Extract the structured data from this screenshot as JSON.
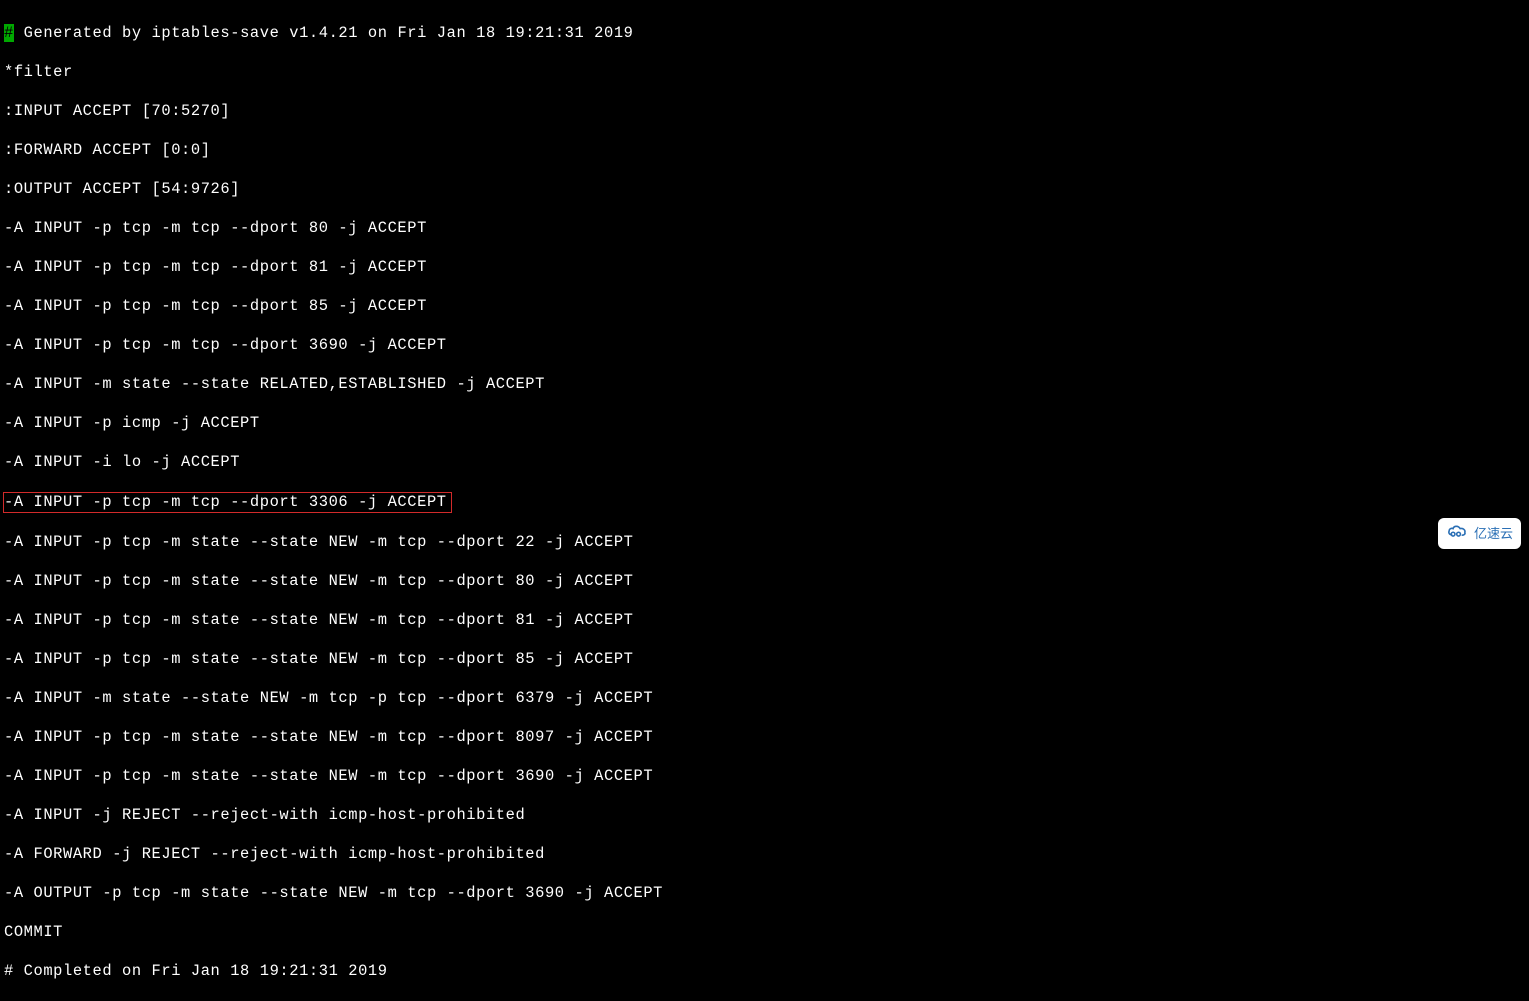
{
  "terminal": {
    "prompt_char": "#",
    "lines": [
      " Generated by iptables-save v1.4.21 on Fri Jan 18 19:21:31 2019",
      "*filter",
      ":INPUT ACCEPT [70:5270]",
      ":FORWARD ACCEPT [0:0]",
      ":OUTPUT ACCEPT [54:9726]",
      "-A INPUT -p tcp -m tcp --dport 80 -j ACCEPT",
      "-A INPUT -p tcp -m tcp --dport 81 -j ACCEPT",
      "-A INPUT -p tcp -m tcp --dport 85 -j ACCEPT",
      "-A INPUT -p tcp -m tcp --dport 3690 -j ACCEPT",
      "-A INPUT -m state --state RELATED,ESTABLISHED -j ACCEPT",
      "-A INPUT -p icmp -j ACCEPT",
      "-A INPUT -i lo -j ACCEPT",
      "-A INPUT -p tcp -m tcp --dport 3306 -j ACCEPT",
      "-A INPUT -p tcp -m state --state NEW -m tcp --dport 22 -j ACCEPT",
      "-A INPUT -p tcp -m state --state NEW -m tcp --dport 80 -j ACCEPT",
      "-A INPUT -p tcp -m state --state NEW -m tcp --dport 81 -j ACCEPT",
      "-A INPUT -p tcp -m state --state NEW -m tcp --dport 85 -j ACCEPT",
      "-A INPUT -m state --state NEW -m tcp -p tcp --dport 6379 -j ACCEPT",
      "-A INPUT -p tcp -m state --state NEW -m tcp --dport 8097 -j ACCEPT",
      "-A INPUT -p tcp -m state --state NEW -m tcp --dport 3690 -j ACCEPT",
      "-A INPUT -j REJECT --reject-with icmp-host-prohibited",
      "-A FORWARD -j REJECT --reject-with icmp-host-prohibited",
      "-A OUTPUT -p tcp -m state --state NEW -m tcp --dport 3690 -j ACCEPT",
      "COMMIT",
      "# Completed on Fri Jan 18 19:21:31 2019"
    ],
    "highlighted_index": 12
  },
  "watermark": {
    "text": "亿速云"
  }
}
